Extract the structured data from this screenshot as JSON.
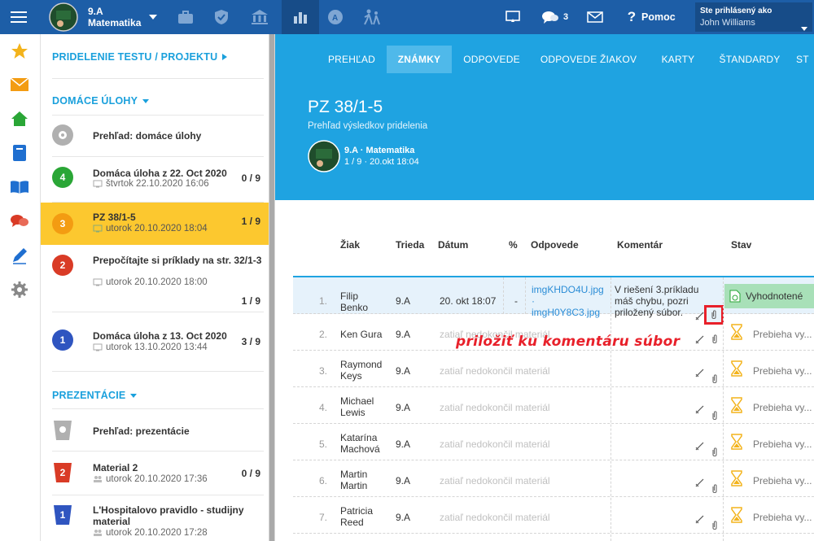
{
  "topbar": {
    "class_name": "9.A",
    "subject": "Matematika",
    "help": "Pomoc",
    "messages_count": "3",
    "logged_as_label": "Ste prihlásený ako",
    "user_name": "John Williams"
  },
  "sidebar": {
    "assign_link": "PRIDELENIE TESTU / PROJEKTU",
    "homework_header": "DOMÁCE ÚLOHY",
    "homework_overview": "Prehľad: domáce úlohy",
    "homework": [
      {
        "num": "4",
        "title": "Domáca úloha z 22. Oct 2020",
        "sub": "štvrtok 22.10.2020 16:06",
        "count": "0 / 9",
        "color": "#2aa636"
      },
      {
        "num": "3",
        "title": "PZ 38/1-5",
        "sub": "utorok 20.10.2020 18:04",
        "count": "1 / 9",
        "color": "#f39c12"
      },
      {
        "num": "2",
        "title": "Prepočítajte si príklady na str. 32/1-3",
        "sub": "utorok 20.10.2020 18:00",
        "count": "1 / 9",
        "color": "#d93b26"
      },
      {
        "num": "1",
        "title": "Domáca úloha z 13. Oct 2020",
        "sub": "utorok 13.10.2020 13:44",
        "count": "3 / 9",
        "color": "#2f55c0"
      }
    ],
    "presentations_header": "PREZENTÁCIE",
    "presentations_overview": "Prehľad: prezentácie",
    "presentations": [
      {
        "num": "2",
        "title": "Material 2",
        "sub": "utorok 20.10.2020 17:36",
        "count": "0 / 9",
        "color": "#d93b26"
      },
      {
        "num": "1",
        "title": "L'Hospitalovo pravidlo - studijny material",
        "sub": "utorok 20.10.2020 17:28",
        "count": "",
        "color": "#2f55c0"
      }
    ]
  },
  "tabs": [
    "PREHĽAD",
    "ZNÁMKY",
    "ODPOVEDE",
    "ODPOVEDE ŽIAKOV",
    "KARTY",
    "ŠTANDARDY",
    "ST"
  ],
  "header": {
    "title": "PZ 38/1-5",
    "subtitle": "Prehľad výsledkov pridelenia",
    "class_line": "9.A · Matematika",
    "meta_line": "1 / 9 · 20.okt 18:04"
  },
  "table": {
    "columns": [
      "Žiak",
      "Trieda",
      "Dátum",
      "%",
      "Odpovede",
      "Komentár",
      "Stav"
    ],
    "rows": [
      {
        "n": "1.",
        "first": "Filip",
        "last": "Benko",
        "class": "9.A",
        "date": "20. okt 18:07",
        "pct": "-",
        "file1": "imgKHDO4U.jpg",
        "dot": "·",
        "file2": "imgH0Y8C3.jpg",
        "comment": "V riešení 3.príkladu máš chybu, pozri priložený súbor.",
        "status": "Vyhodnotené"
      },
      {
        "n": "2.",
        "first": "Ken Gura",
        "last": "",
        "class": "9.A",
        "date": "zatiaľ nedokončil materiál",
        "status": "Prebieha vy..."
      },
      {
        "n": "3.",
        "first": "Raymond",
        "last": "Keys",
        "class": "9.A",
        "date": "zatiaľ nedokončil materiál",
        "status": "Prebieha vy..."
      },
      {
        "n": "4.",
        "first": "Michael",
        "last": "Lewis",
        "class": "9.A",
        "date": "zatiaľ nedokončil materiál",
        "status": "Prebieha vy..."
      },
      {
        "n": "5.",
        "first": "Katarína",
        "last": "Machová",
        "class": "9.A",
        "date": "zatiaľ nedokončil materiál",
        "status": "Prebieha vy..."
      },
      {
        "n": "6.",
        "first": "Martin",
        "last": "Martin",
        "class": "9.A",
        "date": "zatiaľ nedokončil materiál",
        "status": "Prebieha vy..."
      },
      {
        "n": "7.",
        "first": "Patricia",
        "last": "Reed",
        "class": "9.A",
        "date": "zatiaľ nedokončil materiál",
        "status": "Prebieha vy..."
      }
    ]
  },
  "annotation": "priložiť ku komentáru súbor",
  "colors": {
    "topbar": "#1d5ea7",
    "accent": "#1aa0dc",
    "highlight": "#fcc82f",
    "annotation": "#e8202a"
  }
}
